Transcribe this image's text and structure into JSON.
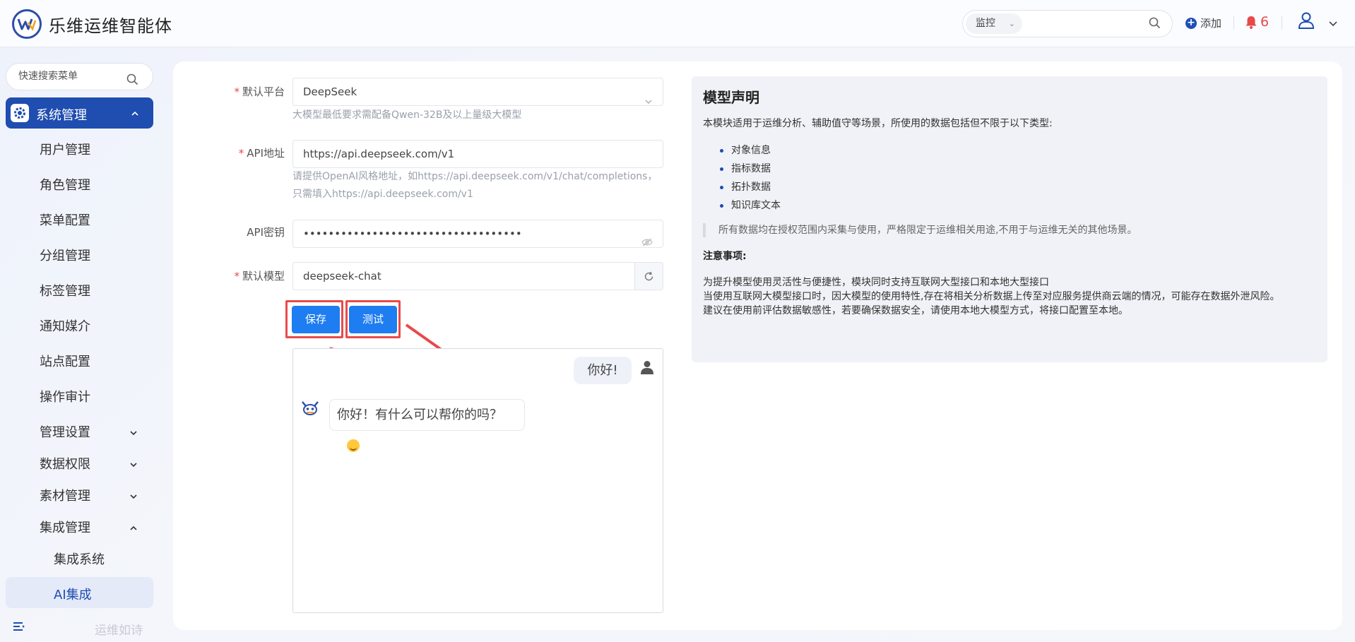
{
  "header": {
    "app_title": "乐维运维智能体",
    "search_select": "监控",
    "add_label": "添加",
    "alert_count": "6"
  },
  "sidebar": {
    "search_placeholder": "快速搜索菜单",
    "active_menu": "系统管理",
    "items": [
      "用户管理",
      "角色管理",
      "菜单配置",
      "分组管理",
      "标签管理",
      "通知媒介",
      "站点配置",
      "操作审计"
    ],
    "groups": [
      "管理设置",
      "数据权限",
      "素材管理",
      "集成管理"
    ],
    "sub_items": [
      "集成系统",
      "AI集成"
    ],
    "footer_text": "运维如诗"
  },
  "form": {
    "platform_label": "默认平台",
    "platform_value": "DeepSeek",
    "platform_hint": "大模型最低要求需配备Qwen-32B及以上量级大模型",
    "api_url_label": "API地址",
    "api_url_value": "https://api.deepseek.com/v1",
    "api_url_hint_1": "请提供OpenAI风格地址，如https://api.deepseek.com/v1/chat/completions，",
    "api_url_hint_2": "只需填入https://api.deepseek.com/v1",
    "api_key_label": "API密钥",
    "api_key_value": "•••••••••••••••••••••••••••••••••••",
    "model_label": "默认模型",
    "model_value": "deepseek-chat",
    "save_label": "保存",
    "test_label": "测试"
  },
  "chat": {
    "user_message": "你好!",
    "bot_message": "你好！有什么可以帮你的吗？"
  },
  "declaration": {
    "title": "模型声明",
    "intro": "本模块适用于运维分析、辅助值守等场景，所使用的数据包括但不限于以下类型:",
    "data_types": [
      "对象信息",
      "指标数据",
      "拓扑数据",
      "知识库文本"
    ],
    "quote": "所有数据均在授权范围内采集与使用，严格限定于运维相关用途,不用于与运维无关的其他场景。",
    "notice_title": "注意事项:",
    "note_1": "为提升模型使用灵活性与便捷性，模块同时支持互联网大型接口和本地大型接口",
    "note_2": "当使用互联网大模型接口时，因大模型的使用特性,存在将相关分析数据上传至对应服务提供商云端的情况，可能存在数据外泄风险。",
    "note_3": "建议在使用前评估数据敏感性，若要确保数据安全，请使用本地大模型方式，将接口配置至本地。"
  },
  "colors": {
    "accent": "#1f4db0",
    "button": "#1e7df0",
    "highlight": "#e84a4a"
  }
}
